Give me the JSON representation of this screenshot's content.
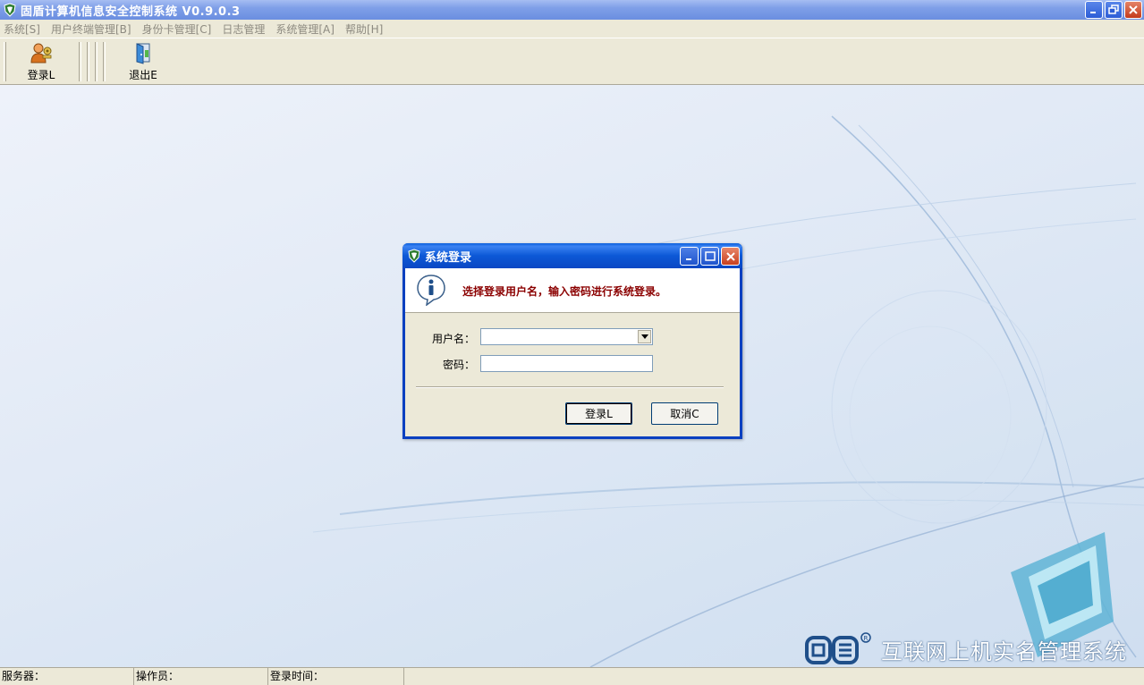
{
  "window": {
    "title": "固盾计算机信息安全控制系统  V0.9.0.3"
  },
  "menu": [
    "系统[S]",
    "用户终端管理[B]",
    "身份卡管理[C]",
    "日志管理",
    "系统管理[A]",
    "帮助[H]"
  ],
  "toolbar": {
    "login_label": "登录L",
    "exit_label": "退出E"
  },
  "branding": {
    "text": "互联网上机实名管理系统"
  },
  "dialog": {
    "title": "系统登录",
    "message": "选择登录用户名，输入密码进行系统登录。",
    "username_label": "用户名：",
    "password_label": "密码：",
    "username_value": "",
    "password_value": "",
    "login_button": "登录L",
    "cancel_button": "取消C"
  },
  "statusbar": {
    "server_label": "服务器：",
    "operator_label": "操作员：",
    "login_time_label": "登录时间："
  },
  "colors": {
    "titlebar_blue": "#0a47c4",
    "message_red": "#8b0000",
    "background_light": "#e2eaf6"
  }
}
